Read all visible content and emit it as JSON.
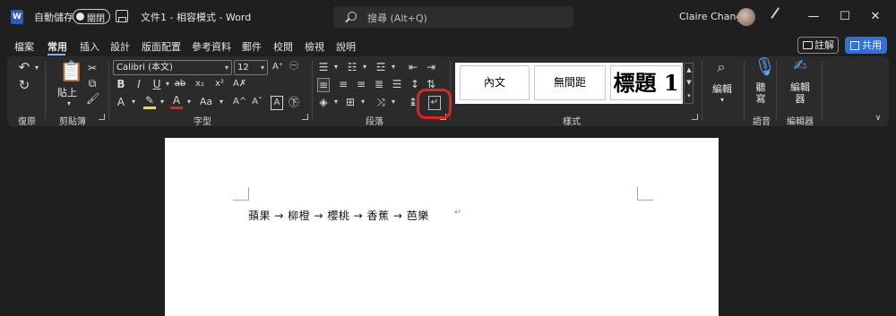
{
  "titlebar": {
    "app_logo": "W",
    "autosave_label": "自動儲存",
    "autosave_toggle": "關閉",
    "doc_title": "文件1 - 相容模式 - Word",
    "search_placeholder": "搜尋 (Alt+Q)",
    "user_name": "Claire Chang",
    "minimize": "—",
    "maximize": "☐",
    "close": "✕"
  },
  "menu": {
    "items": [
      "檔案",
      "常用",
      "插入",
      "設計",
      "版面配置",
      "參考資料",
      "郵件",
      "校閱",
      "檢視",
      "說明"
    ],
    "active": "常用",
    "comment_label": "註解",
    "share_label": "共用"
  },
  "ribbon": {
    "undo_group": "復原",
    "clipboard_group": "剪貼簿",
    "paste_label": "貼上",
    "font_group": "字型",
    "font_name": "Calibri (本文)",
    "font_size": "12",
    "paragraph_group": "段落",
    "styles_group": "樣式",
    "styles": [
      "內文",
      "無間距",
      "標題 1"
    ],
    "editing_label": "編輯",
    "dictate_label": "聽寫",
    "voice_group": "語音",
    "editor_label": "編輯器",
    "editor_group": "編輯器"
  },
  "document": {
    "line": "蘋果 → 柳橙 → 櫻桃 → 香蕉 → 芭樂"
  },
  "colors": {
    "accent": "#2f6fde",
    "highlight_ring": "#e52222",
    "ribbon_bg": "#2b2b2b",
    "app_bg": "#1f1f1f"
  }
}
